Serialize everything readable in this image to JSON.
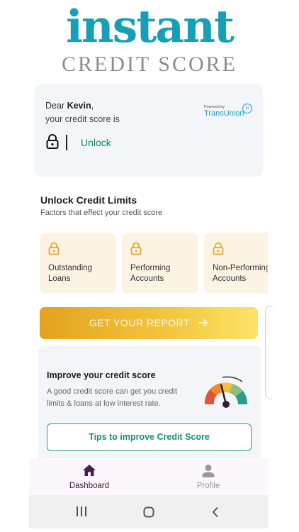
{
  "logo": {
    "line1": "instant",
    "line2": "CREDIT SCORE"
  },
  "score_card": {
    "greeting_prefix": "Dear ",
    "user_name": "Kevin",
    "greeting_suffix": ",",
    "subtitle": "your credit score is",
    "provider_powered": "Powered by",
    "provider_name": "TransUnion",
    "provider_badge": "tu",
    "unlock_label": "Unlock"
  },
  "unlock_section": {
    "title": "Unlock Credit Limits",
    "subtitle": "Factors that effect your credit score",
    "factors": [
      {
        "line1": "Outstanding",
        "line2": "Loans",
        "icon": "lock-icon"
      },
      {
        "line1": "Performing",
        "line2": "Accounts",
        "icon": "lock-icon"
      },
      {
        "line1": "Non-Performing",
        "line2": "Accounts",
        "icon": "lock-icon"
      }
    ]
  },
  "report_button": {
    "label": "GET YOUR REPORT",
    "icon": "arrow-right-icon"
  },
  "improve": {
    "title": "Improve your credit score",
    "desc_line1": "A good credit score can get you credit",
    "desc_line2": "limits & loans at low interest rate.",
    "tips_button": "Tips to improve Credit Score",
    "icon": "credit-gauge-icon"
  },
  "bottom_nav": {
    "items": [
      {
        "label": "Dashboard",
        "icon": "home-icon",
        "active": true
      },
      {
        "label": "Profile",
        "icon": "person-icon",
        "active": false
      }
    ]
  },
  "system_nav": {
    "icons": [
      "recent-apps-icon",
      "home-circle-icon",
      "back-icon"
    ]
  },
  "colors": {
    "brand_teal": "#16a0b8",
    "accent_green": "#1a7f6e",
    "gold": "#e3a21d",
    "nav_active": "#4a1f4a"
  }
}
